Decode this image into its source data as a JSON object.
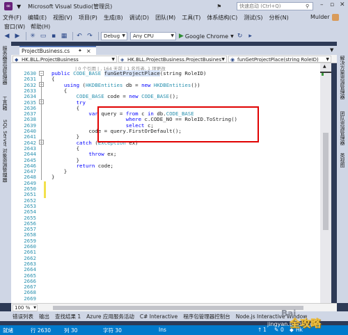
{
  "window": {
    "title": "Microsoft Visual Studio(管理员)",
    "quick_launch_placeholder": "快速启动 (Ctrl+Q)",
    "flags_label": "▼"
  },
  "menu": {
    "items": [
      "文件(F)",
      "编辑(E)",
      "视图(V)",
      "项目(P)",
      "生成(B)",
      "调试(D)",
      "团队(M)",
      "工具(T)",
      "体系结构(C)",
      "测试(S)",
      "分析(N)"
    ],
    "user": "Mulder",
    "sub_items": [
      "窗口(W)",
      "帮助(H)"
    ]
  },
  "toolbar": {
    "config": "Debug",
    "platform": "Any CPU",
    "run_label": "Google Chrome"
  },
  "left_strip": [
    "服务器资源管理器",
    "工具箱",
    "SQL Server 对象资源管理器"
  ],
  "right_strip": [
    "解决方案资源管理器",
    "团队资源管理器",
    "类视图"
  ],
  "doc_tab": {
    "name": "ProjectBusiness.cs",
    "pin": "✦",
    "close": "×"
  },
  "nav": {
    "project": "HK.BLL.ProjectBusiness",
    "class": "HK.BLL.ProjectBusiness.ProjectBusines",
    "member": "funGetProjectPlace(string RoleID)"
  },
  "editor": {
    "codelens": "| 0 个引用 | , 164 天前 | 1 名作者, 1 项更改",
    "lines": [
      {
        "n": "2630",
        "code": "public CODE_BASE funGetProjectPlace(string RoleID)"
      },
      {
        "n": "2631",
        "code": "{"
      },
      {
        "n": "2632",
        "code": "    using (HKDBEntities db = new HKDBEntities())"
      },
      {
        "n": "2633",
        "code": "    {"
      },
      {
        "n": "2634",
        "code": "        CODE_BASE code = new CODE_BASE();"
      },
      {
        "n": "2635",
        "code": "        try"
      },
      {
        "n": "2636",
        "code": "        {"
      },
      {
        "n": "2637",
        "code": "            var query = from c in db.CODE_BASE"
      },
      {
        "n": "2638",
        "code": "                        where c.CODE_NO == RoleID.ToString()"
      },
      {
        "n": "2639",
        "code": "                        select c;"
      },
      {
        "n": "2640",
        "code": "            code = query.FirstOrDefault();"
      },
      {
        "n": "2641",
        "code": "        }"
      },
      {
        "n": "2642",
        "code": "        catch (Exception ex)"
      },
      {
        "n": "2643",
        "code": "        {"
      },
      {
        "n": "2644",
        "code": "            throw ex;"
      },
      {
        "n": "2645",
        "code": "        }"
      },
      {
        "n": "2646",
        "code": "        return code;"
      },
      {
        "n": "2647",
        "code": "    }"
      },
      {
        "n": "2648",
        "code": "}"
      },
      {
        "n": "2649",
        "code": ""
      },
      {
        "n": "2650",
        "code": ""
      },
      {
        "n": "2651",
        "code": ""
      },
      {
        "n": "2652",
        "code": ""
      },
      {
        "n": "2653",
        "code": ""
      },
      {
        "n": "2654",
        "code": ""
      },
      {
        "n": "2655",
        "code": ""
      },
      {
        "n": "2656",
        "code": ""
      },
      {
        "n": "2657",
        "code": ""
      },
      {
        "n": "2658",
        "code": ""
      },
      {
        "n": "2659",
        "code": ""
      },
      {
        "n": "2660",
        "code": ""
      },
      {
        "n": "2661",
        "code": ""
      },
      {
        "n": "2662",
        "code": ""
      },
      {
        "n": "2663",
        "code": ""
      },
      {
        "n": "2664",
        "code": ""
      },
      {
        "n": "2665",
        "code": ""
      },
      {
        "n": "2666",
        "code": ""
      },
      {
        "n": "2667",
        "code": ""
      },
      {
        "n": "2668",
        "code": ""
      },
      {
        "n": "2669",
        "code": ""
      }
    ]
  },
  "zoom": "100 %",
  "bottom_tabs": [
    "错误列表",
    "输出",
    "查找结果 1",
    "Azure 应用服务活动",
    "C# Interactive",
    "程序包管理器控制台",
    "Node.js Interactive Window"
  ],
  "status": {
    "ready": "就绪",
    "row": "行 2630",
    "col": "列 30",
    "ch": "字符 30",
    "ins": "Ins",
    "count_up": "1",
    "count_pencil": "0",
    "branch": "Hk"
  },
  "watermark": {
    "main": "全攻略",
    "site": "jingyan.baidu.com",
    "logo": "Bai"
  },
  "colors": {
    "chrome": "#cfd6e5",
    "status": "#007acc",
    "highlight_box": "#e00000",
    "keyword": "#0000ff",
    "type": "#2b91af"
  }
}
